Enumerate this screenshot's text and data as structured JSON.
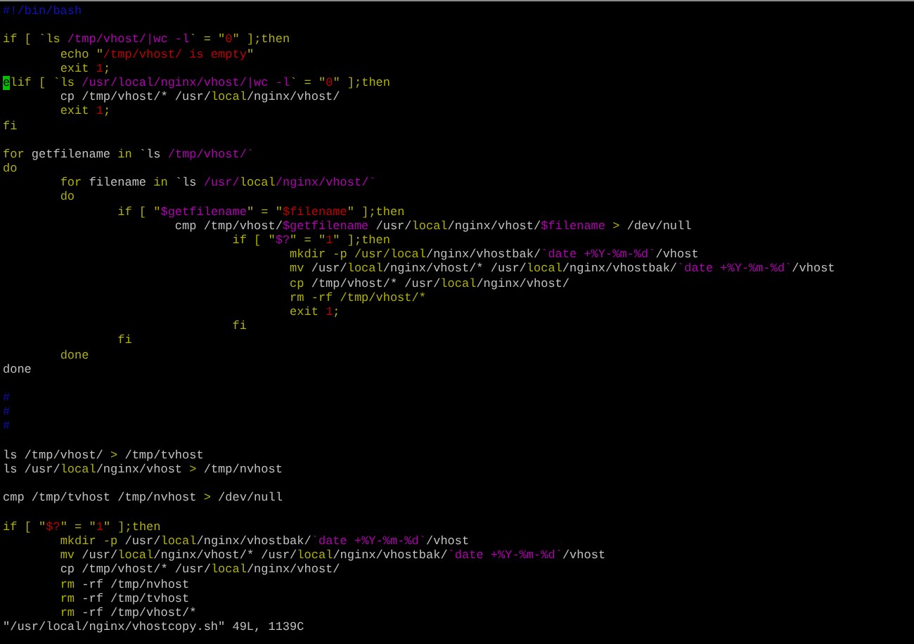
{
  "editor": {
    "lines": [
      {
        "kind": "code",
        "segments": [
          {
            "text": "#!/bin/bash",
            "kind": "comment"
          }
        ]
      },
      {
        "kind": "blank"
      },
      {
        "kind": "code",
        "segments": [
          {
            "text": "if [ `ls ",
            "kind": "keyword"
          },
          {
            "text": "/tmp/vhost/|wc -l",
            "kind": "subst"
          },
          {
            "text": "` = \"",
            "kind": "keyword"
          },
          {
            "text": "0",
            "kind": "string"
          },
          {
            "text": "\" ];then",
            "kind": "keyword"
          }
        ]
      },
      {
        "kind": "code",
        "segments": [
          {
            "text": "\techo \"",
            "kind": "keyword"
          },
          {
            "text": "/tmp/vhost/ is empty",
            "kind": "string"
          },
          {
            "text": "\"",
            "kind": "keyword"
          }
        ]
      },
      {
        "kind": "code",
        "segments": [
          {
            "text": "\texit ",
            "kind": "keyword"
          },
          {
            "text": "1",
            "kind": "string"
          },
          {
            "text": ";",
            "kind": "keyword"
          }
        ]
      },
      {
        "kind": "code",
        "segments": [
          {
            "text": "e",
            "kind": "cursor"
          },
          {
            "text": "lif [ `ls ",
            "kind": "keyword"
          },
          {
            "text": "/usr/local/nginx/vhost/|wc -l",
            "kind": "subst"
          },
          {
            "text": "` = \"",
            "kind": "keyword"
          },
          {
            "text": "0",
            "kind": "string"
          },
          {
            "text": "\" ];then",
            "kind": "keyword"
          }
        ]
      },
      {
        "kind": "code",
        "segments": [
          {
            "text": "\tcp /tmp/vhost/* /usr/",
            "kind": "plain"
          },
          {
            "text": "local",
            "kind": "keyword"
          },
          {
            "text": "/nginx/vhost/",
            "kind": "plain"
          }
        ]
      },
      {
        "kind": "code",
        "segments": [
          {
            "text": "\texit ",
            "kind": "keyword"
          },
          {
            "text": "1",
            "kind": "string"
          },
          {
            "text": ";",
            "kind": "keyword"
          }
        ]
      },
      {
        "kind": "code",
        "segments": [
          {
            "text": "fi",
            "kind": "keyword"
          }
        ]
      },
      {
        "kind": "blank"
      },
      {
        "kind": "code",
        "segments": [
          {
            "text": "for",
            "kind": "keyword"
          },
          {
            "text": " getfilename ",
            "kind": "plain"
          },
          {
            "text": "in",
            "kind": "keyword"
          },
          {
            "text": " `ls ",
            "kind": "plain"
          },
          {
            "text": "/tmp/vhost/`",
            "kind": "subst"
          }
        ]
      },
      {
        "kind": "code",
        "segments": [
          {
            "text": "do",
            "kind": "keyword"
          }
        ]
      },
      {
        "kind": "code",
        "segments": [
          {
            "text": "\tfor",
            "kind": "keyword"
          },
          {
            "text": " filename ",
            "kind": "plain"
          },
          {
            "text": "in",
            "kind": "keyword"
          },
          {
            "text": " `ls ",
            "kind": "plain"
          },
          {
            "text": "/usr/",
            "kind": "subst"
          },
          {
            "text": "local",
            "kind": "keyword"
          },
          {
            "text": "/nginx/vhost/`",
            "kind": "subst"
          }
        ]
      },
      {
        "kind": "code",
        "segments": [
          {
            "text": "\tdo",
            "kind": "keyword"
          }
        ]
      },
      {
        "kind": "code",
        "segments": [
          {
            "text": "\t\tif [ \"",
            "kind": "keyword"
          },
          {
            "text": "$getfilename",
            "kind": "subst"
          },
          {
            "text": "\" = \"",
            "kind": "keyword"
          },
          {
            "text": "$filename",
            "kind": "string"
          },
          {
            "text": "\" ];then",
            "kind": "keyword"
          }
        ]
      },
      {
        "kind": "code",
        "segments": [
          {
            "text": "\t\t\tcmp /tmp/vhost/",
            "kind": "plain"
          },
          {
            "text": "$getfilename",
            "kind": "subst"
          },
          {
            "text": " /usr/",
            "kind": "plain"
          },
          {
            "text": "local",
            "kind": "keyword"
          },
          {
            "text": "/nginx/vhost/",
            "kind": "plain"
          },
          {
            "text": "$filename",
            "kind": "subst"
          },
          {
            "text": " >",
            "kind": "keyword"
          },
          {
            "text": " /dev/null",
            "kind": "plain"
          }
        ]
      },
      {
        "kind": "code",
        "segments": [
          {
            "text": "\t\t\t\tif [ \"",
            "kind": "keyword"
          },
          {
            "text": "$?",
            "kind": "subst"
          },
          {
            "text": "\" = \"",
            "kind": "keyword"
          },
          {
            "text": "1",
            "kind": "string"
          },
          {
            "text": "\" ];then",
            "kind": "keyword"
          }
        ]
      },
      {
        "kind": "code",
        "segments": [
          {
            "text": "\t\t\t\t\tmkdir -p /usr/local",
            "kind": "keyword"
          },
          {
            "text": "/nginx/vhostbak/",
            "kind": "plain"
          },
          {
            "text": "`date +%Y-%m-%d`",
            "kind": "subst"
          },
          {
            "text": "/vhost",
            "kind": "plain"
          }
        ]
      },
      {
        "kind": "code",
        "segments": [
          {
            "text": "\t\t\t\t\tmv",
            "kind": "keyword"
          },
          {
            "text": " /usr/",
            "kind": "plain"
          },
          {
            "text": "local",
            "kind": "keyword"
          },
          {
            "text": "/nginx/vhost/* /usr/",
            "kind": "plain"
          },
          {
            "text": "local",
            "kind": "keyword"
          },
          {
            "text": "/nginx/vhostbak/",
            "kind": "plain"
          },
          {
            "text": "`date +%Y-%m-%d`",
            "kind": "subst"
          },
          {
            "text": "/vhost",
            "kind": "plain"
          }
        ]
      },
      {
        "kind": "code",
        "segments": [
          {
            "text": "\t\t\t\t\tcp",
            "kind": "keyword"
          },
          {
            "text": " /tmp/vhost/* /usr/",
            "kind": "plain"
          },
          {
            "text": "local",
            "kind": "keyword"
          },
          {
            "text": "/nginx/vhost/",
            "kind": "plain"
          }
        ]
      },
      {
        "kind": "code",
        "segments": [
          {
            "text": "\t\t\t\t\trm -rf /tmp/vhost/*",
            "kind": "keyword"
          }
        ]
      },
      {
        "kind": "code",
        "segments": [
          {
            "text": "\t\t\t\t\texit ",
            "kind": "keyword"
          },
          {
            "text": "1",
            "kind": "string"
          },
          {
            "text": ";",
            "kind": "keyword"
          }
        ]
      },
      {
        "kind": "code",
        "segments": [
          {
            "text": "\t\t\t\tfi",
            "kind": "keyword"
          }
        ]
      },
      {
        "kind": "code",
        "segments": [
          {
            "text": "\t\tfi",
            "kind": "keyword"
          }
        ]
      },
      {
        "kind": "code",
        "segments": [
          {
            "text": "\tdone",
            "kind": "keyword"
          }
        ]
      },
      {
        "kind": "code",
        "segments": [
          {
            "text": "done",
            "kind": "plain"
          }
        ]
      },
      {
        "kind": "blank"
      },
      {
        "kind": "code",
        "segments": [
          {
            "text": "#",
            "kind": "comment"
          }
        ]
      },
      {
        "kind": "code",
        "segments": [
          {
            "text": "#",
            "kind": "comment"
          }
        ]
      },
      {
        "kind": "code",
        "segments": [
          {
            "text": "#",
            "kind": "comment"
          }
        ]
      },
      {
        "kind": "blank"
      },
      {
        "kind": "code",
        "segments": [
          {
            "text": "ls /tmp/vhost/ ",
            "kind": "plain"
          },
          {
            "text": ">",
            "kind": "keyword"
          },
          {
            "text": " /tmp/tvhost",
            "kind": "plain"
          }
        ]
      },
      {
        "kind": "code",
        "segments": [
          {
            "text": "ls /usr/",
            "kind": "plain"
          },
          {
            "text": "local",
            "kind": "keyword"
          },
          {
            "text": "/nginx/vhost ",
            "kind": "plain"
          },
          {
            "text": ">",
            "kind": "keyword"
          },
          {
            "text": " /tmp/nvhost",
            "kind": "plain"
          }
        ]
      },
      {
        "kind": "blank"
      },
      {
        "kind": "code",
        "segments": [
          {
            "text": "cmp /tmp/tvhost /tmp/nvhost ",
            "kind": "plain"
          },
          {
            "text": ">",
            "kind": "keyword"
          },
          {
            "text": " /dev/null",
            "kind": "plain"
          }
        ]
      },
      {
        "kind": "blank"
      },
      {
        "kind": "code",
        "segments": [
          {
            "text": "if [ \"",
            "kind": "keyword"
          },
          {
            "text": "$?",
            "kind": "string"
          },
          {
            "text": "\" = \"",
            "kind": "keyword"
          },
          {
            "text": "1",
            "kind": "string"
          },
          {
            "text": "\" ];then",
            "kind": "keyword"
          }
        ]
      },
      {
        "kind": "code",
        "segments": [
          {
            "text": "\tmkdir -p",
            "kind": "keyword"
          },
          {
            "text": " /usr/",
            "kind": "plain"
          },
          {
            "text": "local",
            "kind": "keyword"
          },
          {
            "text": "/nginx/vhostbak/",
            "kind": "plain"
          },
          {
            "text": "`date +%Y-%m-%d`",
            "kind": "subst"
          },
          {
            "text": "/vhost",
            "kind": "plain"
          }
        ]
      },
      {
        "kind": "code",
        "segments": [
          {
            "text": "\tmv",
            "kind": "keyword"
          },
          {
            "text": " /usr/",
            "kind": "plain"
          },
          {
            "text": "local",
            "kind": "keyword"
          },
          {
            "text": "/nginx/vhost/* /usr/",
            "kind": "plain"
          },
          {
            "text": "local",
            "kind": "keyword"
          },
          {
            "text": "/nginx/vhostbak/",
            "kind": "plain"
          },
          {
            "text": "`date +%Y-%m-%d`",
            "kind": "subst"
          },
          {
            "text": "/vhost",
            "kind": "plain"
          }
        ]
      },
      {
        "kind": "code",
        "segments": [
          {
            "text": "\tcp /tmp/vhost/* /usr/",
            "kind": "plain"
          },
          {
            "text": "local",
            "kind": "keyword"
          },
          {
            "text": "/nginx/vhost/",
            "kind": "plain"
          }
        ]
      },
      {
        "kind": "code",
        "segments": [
          {
            "text": "\trm",
            "kind": "keyword"
          },
          {
            "text": " -rf /tmp/nvhost",
            "kind": "plain"
          }
        ]
      },
      {
        "kind": "code",
        "segments": [
          {
            "text": "\trm",
            "kind": "keyword"
          },
          {
            "text": " -rf /tmp/tvhost",
            "kind": "plain"
          }
        ]
      },
      {
        "kind": "code",
        "segments": [
          {
            "text": "\trm",
            "kind": "keyword"
          },
          {
            "text": " -rf /tmp/vhost/*",
            "kind": "plain"
          }
        ]
      }
    ],
    "status_line": "\"/usr/local/nginx/vhostcopy.sh\" 49L, 1139C"
  }
}
